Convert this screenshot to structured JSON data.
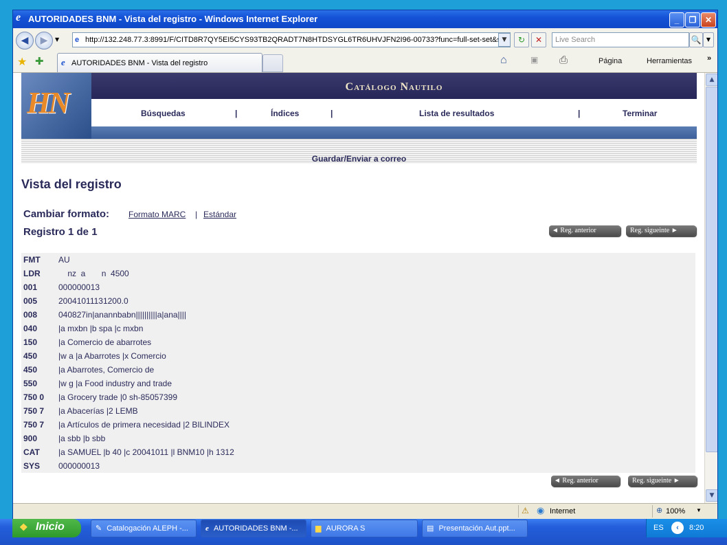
{
  "window": {
    "title": "AUTORIDADES BNM - Vista del registro - Windows Internet Explorer",
    "minimize": "_",
    "restore": "❐",
    "close": "✕"
  },
  "toolbar": {
    "back": "◀",
    "forward": "▶",
    "address": "http://132.248.77.3:8991/F/CITD8R7QY5EI5CYS93TB2QRADT7N8HTDSYGL6TR6UHVJFN2I96-00733?func=full-set-set&set_",
    "refresh": "↻",
    "stop": "✕",
    "search_placeholder": "Live Search",
    "search_button": "🔍"
  },
  "tabs": {
    "active_label": "AUTORIDADES BNM - Vista del registro",
    "favorites_star": "★",
    "add_favorite": "✚",
    "home": "⌂",
    "feeds": "▣",
    "print": "⎙",
    "page_menu": "Página",
    "tools_menu": "Herramientas",
    "overflow": "»"
  },
  "page": {
    "logo_text": "HN",
    "banner_title": "Catálogo Nautilo",
    "menu": [
      "Búsquedas",
      "Índices",
      "Lista de resultados",
      "Terminar"
    ],
    "separator": "|",
    "save_link": "Guardar/Enviar a correo",
    "title": "Vista del registro",
    "format_label": "Cambiar formato:",
    "format_marc": "Formato MARC",
    "format_std": "Estándar",
    "record_label": "Registro 1 de 1",
    "prev_label": "◄ Reg. anterior",
    "next_label": "Reg. sigueinte ►"
  },
  "record": [
    {
      "tag": "FMT",
      "value": "AU"
    },
    {
      "tag": "LDR",
      "value": "    nz  a       n  4500"
    },
    {
      "tag": "001",
      "value": "000000013"
    },
    {
      "tag": "005",
      "value": "20041011131200.0"
    },
    {
      "tag": "008",
      "value": "040827in|anannbabn||||||||||a|ana||||"
    },
    {
      "tag": "040",
      "value": "|a mxbn |b spa |c mxbn"
    },
    {
      "tag": "150",
      "value": "|a Comercio de abarrotes"
    },
    {
      "tag": "450",
      "value": "|w a |a Abarrotes |x Comercio"
    },
    {
      "tag": "450",
      "value": "|a Abarrotes, Comercio de"
    },
    {
      "tag": "550",
      "value": "|w g |a Food industry and trade"
    },
    {
      "tag": "750 0",
      "value": "|a Grocery trade |0 sh-85057399"
    },
    {
      "tag": "750 7",
      "value": "|a Abacerías |2 LEMB"
    },
    {
      "tag": "750 7",
      "value": "|a Artículos de primera necesidad |2 BILINDEX"
    },
    {
      "tag": "900",
      "value": "|a sbb |b sbb"
    },
    {
      "tag": "CAT",
      "value": "|a SAMUEL |b 40 |c 20041011 |l BNM10 |h 1312"
    },
    {
      "tag": "SYS",
      "value": "000000013"
    }
  ],
  "status": {
    "zone": "Internet",
    "zoom": "100%"
  },
  "taskbar": {
    "start": "Inicio",
    "tasks": [
      "Catalogación ALEPH -...",
      "AUTORIDADES BNM -...",
      "AURORA S",
      "Presentación.Aut.ppt..."
    ],
    "lang": "ES",
    "time": "8:20"
  }
}
